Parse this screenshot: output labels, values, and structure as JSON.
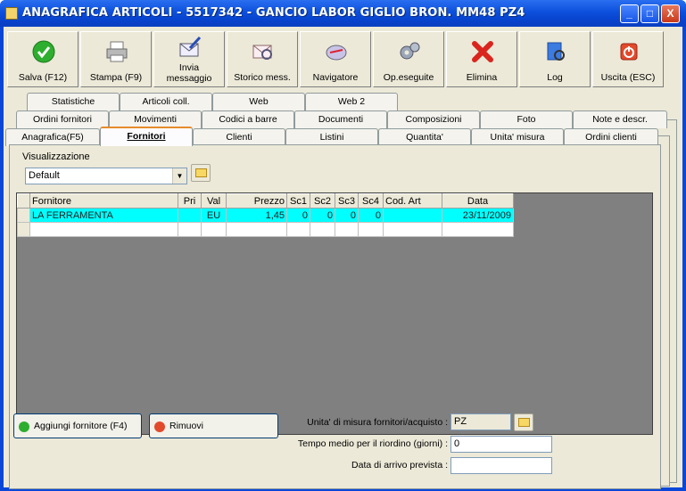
{
  "window": {
    "title": "ANAGRAFICA ARTICOLI - 5517342 - GANCIO LABOR  GIGLIO BRON. MM48 PZ4"
  },
  "titlebar_buttons": {
    "minimize": "_",
    "maximize": "□",
    "close": "X"
  },
  "toolbar": [
    {
      "label": "Salva (F12)",
      "icon": "check-icon"
    },
    {
      "label": "Stampa (F9)",
      "icon": "printer-icon"
    },
    {
      "label": "Invia\nmessaggio",
      "icon": "envelope-pen-icon"
    },
    {
      "label": "Storico mess.",
      "icon": "envelope-search-icon"
    },
    {
      "label": "Navigatore",
      "icon": "compass-icon"
    },
    {
      "label": "Op.eseguite",
      "icon": "gears-icon"
    },
    {
      "label": "Elimina",
      "icon": "red-x-icon"
    },
    {
      "label": "Log",
      "icon": "log-book-icon"
    },
    {
      "label": "Uscita (ESC)",
      "icon": "exit-icon"
    }
  ],
  "tabs": {
    "row1": [
      "Statistiche",
      "Articoli coll.",
      "Web",
      "Web 2"
    ],
    "row2": [
      "Ordini fornitori",
      "Movimenti",
      "Codici a barre",
      "Documenti",
      "Composizioni",
      "Foto",
      "Note e descr."
    ],
    "row3": [
      "Anagrafica(F5)",
      "Fornitori",
      "Clienti",
      "Listini",
      "Quantita'",
      "Unita' misura",
      "Ordini clienti"
    ],
    "active": "Fornitori"
  },
  "visualizzazione": {
    "label": "Visualizzazione",
    "value": "Default"
  },
  "table": {
    "columns": [
      "Fornitore",
      "Pri",
      "Val",
      "Prezzo",
      "Sc1",
      "Sc2",
      "Sc3",
      "Sc4",
      "Cod. Art",
      "Data"
    ],
    "rows": [
      [
        "LA FERRAMENTA",
        "",
        "EU",
        "1,45",
        "0",
        "0",
        "0",
        "0",
        "",
        "23/11/2009"
      ]
    ]
  },
  "buttons": {
    "add": "Aggiungi fornitore (F4)",
    "remove": "Rimuovi"
  },
  "fields": {
    "um_label": "Unita' di misura fornitori/acquisto :",
    "um_value": "PZ",
    "tempo_label": "Tempo medio per il riordino (giorni) :",
    "tempo_value": "0",
    "arrivo_label": "Data di arrivo prevista :",
    "arrivo_value": ""
  },
  "colors": {
    "titlebar": "#0c4fdc",
    "selected_row": "#00ffff",
    "face": "#ece9d8"
  }
}
